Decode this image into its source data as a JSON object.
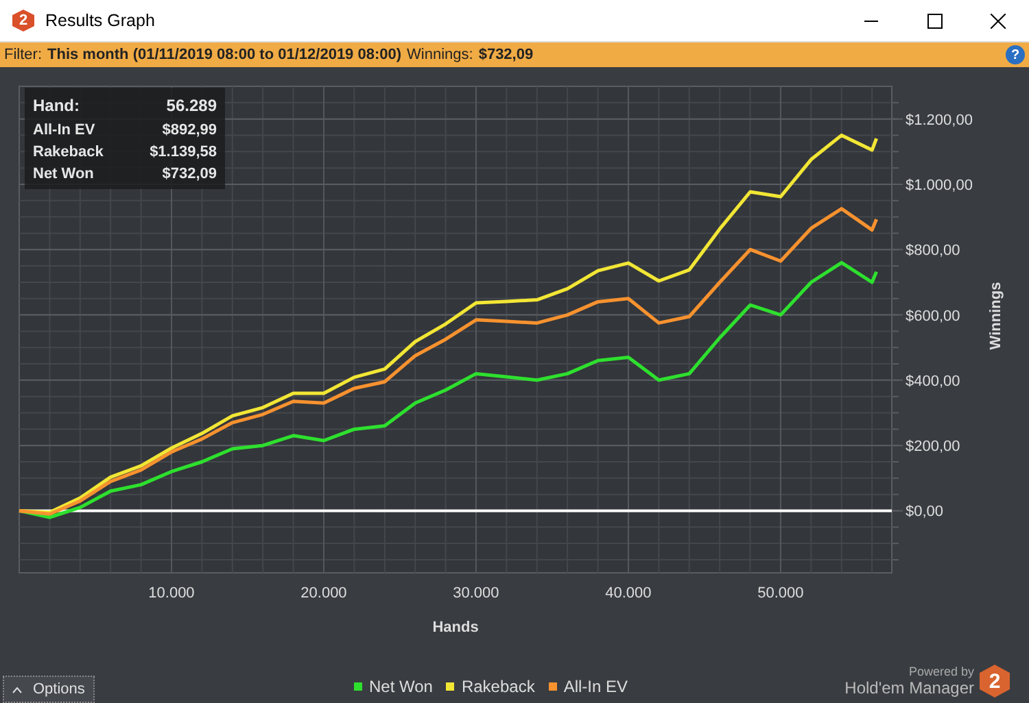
{
  "window": {
    "title": "Results Graph",
    "icon_text": "2"
  },
  "filter_bar": {
    "label": "Filter:",
    "value": "This month (01/11/2019 08:00 to 01/12/2019 08:00)",
    "winnings_label": "Winnings:",
    "winnings_value": "$732,09",
    "help": "?"
  },
  "tooltip": {
    "rows": [
      {
        "label": "Hand:",
        "value": "56.289"
      },
      {
        "label": "All-In EV",
        "value": "$892,99"
      },
      {
        "label": "Rakeback",
        "value": "$1.139,58"
      },
      {
        "label": "Net Won",
        "value": "$732,09"
      }
    ]
  },
  "chart_data": {
    "type": "line",
    "xlabel": "Hands",
    "ylabel": "Winnings",
    "grid": true,
    "xlim": [
      0,
      57300
    ],
    "ylim": [
      -190,
      1300
    ],
    "xticks": [
      {
        "value": 10000,
        "label": "10.000"
      },
      {
        "value": 20000,
        "label": "20.000"
      },
      {
        "value": 30000,
        "label": "30.000"
      },
      {
        "value": 40000,
        "label": "40.000"
      },
      {
        "value": 50000,
        "label": "50.000"
      }
    ],
    "yticks": [
      {
        "value": 0,
        "label": "$0,00"
      },
      {
        "value": 200,
        "label": "$200,00"
      },
      {
        "value": 400,
        "label": "$400,00"
      },
      {
        "value": 600,
        "label": "$600,00"
      },
      {
        "value": 800,
        "label": "$800,00"
      },
      {
        "value": 1000,
        "label": "$1.000,00"
      },
      {
        "value": 1200,
        "label": "$1.200,00"
      }
    ],
    "x": [
      0,
      2000,
      4000,
      6000,
      8000,
      10000,
      12000,
      14000,
      16000,
      18000,
      20000,
      22000,
      24000,
      26000,
      28000,
      30000,
      32000,
      34000,
      36000,
      38000,
      40000,
      42000,
      44000,
      46000,
      48000,
      50000,
      52000,
      54000,
      56000,
      56289
    ],
    "series": [
      {
        "name": "Net Won",
        "color": "#2ee02e",
        "values": [
          0,
          -20,
          10,
          60,
          80,
          120,
          150,
          190,
          200,
          230,
          215,
          250,
          260,
          330,
          370,
          420,
          410,
          400,
          420,
          460,
          470,
          400,
          420,
          530,
          630,
          600,
          700,
          760,
          700,
          732
        ]
      },
      {
        "name": "Rakeback",
        "color": "#f2e635",
        "values": [
          0,
          -5,
          39,
          103,
          138,
          192,
          237,
          291,
          316,
          360,
          360,
          409,
          434,
          518,
          572,
          637,
          641,
          646,
          680,
          735,
          759,
          704,
          738,
          863,
          977,
          962,
          1076,
          1150,
          1105,
          1140
        ]
      },
      {
        "name": "All-In EV",
        "color": "#f7922f",
        "values": [
          0,
          -10,
          30,
          90,
          125,
          180,
          220,
          270,
          295,
          335,
          330,
          375,
          395,
          475,
          525,
          585,
          580,
          575,
          600,
          640,
          650,
          575,
          595,
          700,
          800,
          765,
          865,
          925,
          860,
          893
        ]
      }
    ]
  },
  "options_button": {
    "label": "Options"
  },
  "branding": {
    "powered_by": "Powered by",
    "product": "Hold'em Manager",
    "logo_text": "2"
  }
}
